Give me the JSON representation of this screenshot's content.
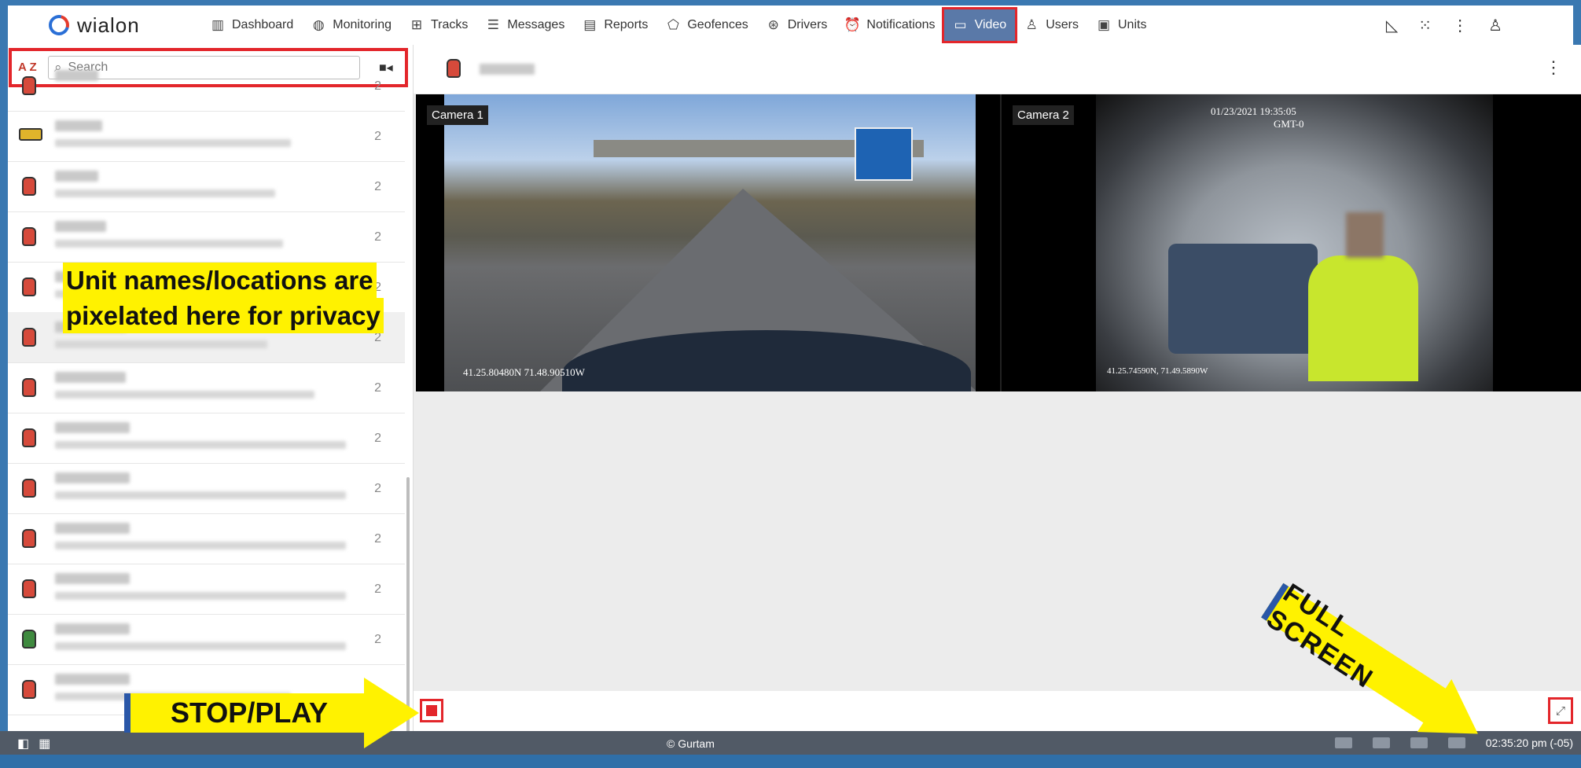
{
  "app": {
    "brand": "wialon"
  },
  "nav": {
    "items": [
      {
        "label": "Dashboard",
        "icon": "chart-icon"
      },
      {
        "label": "Monitoring",
        "icon": "globe-icon"
      },
      {
        "label": "Tracks",
        "icon": "tracks-icon"
      },
      {
        "label": "Messages",
        "icon": "messages-icon"
      },
      {
        "label": "Reports",
        "icon": "reports-icon"
      },
      {
        "label": "Geofences",
        "icon": "geofence-icon"
      },
      {
        "label": "Drivers",
        "icon": "steering-wheel-icon"
      },
      {
        "label": "Notifications",
        "icon": "alarm-icon"
      },
      {
        "label": "Video",
        "icon": "video-icon",
        "active": true
      },
      {
        "label": "Users",
        "icon": "user-icon"
      },
      {
        "label": "Units",
        "icon": "bus-icon"
      }
    ]
  },
  "sidebar": {
    "search_placeholder": "Search",
    "sort_label": "A Z",
    "unit_count": "2"
  },
  "video": {
    "camera1_label": "Camera 1",
    "camera2_label": "Camera 2",
    "camera1_coords": "41.25.80480N 71.48.90510W",
    "camera2_coords": "41.25.74590N, 71.49.5890W",
    "camera2_timestamp": "01/23/2021 19:35:05",
    "camera2_tz": "GMT-0"
  },
  "annotations": {
    "privacy_line1": "Unit names/locations are",
    "privacy_line2": "pixelated here for privacy",
    "stop_play": "STOP/PLAY",
    "full_screen": "FULL SCREEN"
  },
  "footer": {
    "copyright": "© Gurtam",
    "time": "02:35:20 pm (-05)"
  },
  "colors": {
    "accent": "#e3262b",
    "nav_active": "#5a79a8",
    "highlight": "#fff200"
  }
}
